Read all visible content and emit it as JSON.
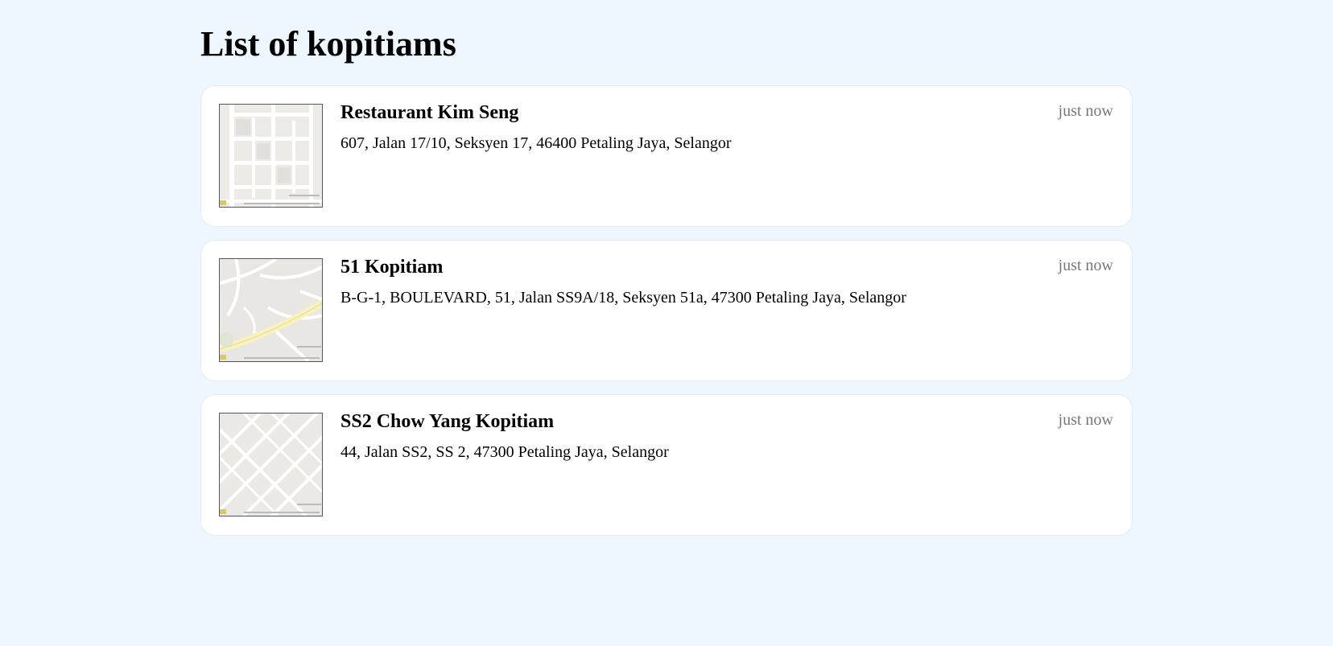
{
  "page": {
    "title": "List of kopitiams"
  },
  "kopitiams": [
    {
      "name": "Restaurant Kim Seng",
      "address": "607, Jalan 17/10, Seksyen 17, 46400 Petaling Jaya, Selangor",
      "time": "just now",
      "thumbnail_icon": "map-thumbnail"
    },
    {
      "name": "51 Kopitiam",
      "address": "B-G-1, BOULEVARD, 51, Jalan SS9A/18, Seksyen 51a, 47300 Petaling Jaya, Selangor",
      "time": "just now",
      "thumbnail_icon": "map-thumbnail"
    },
    {
      "name": "SS2 Chow Yang Kopitiam",
      "address": "44, Jalan SS2, SS 2, 47300 Petaling Jaya, Selangor",
      "time": "just now",
      "thumbnail_icon": "map-thumbnail"
    }
  ],
  "colors": {
    "background": "#eef6fe",
    "card": "#ffffff",
    "time_text": "#777777",
    "map_land": "#e8e6e2",
    "map_road": "#ffffff",
    "map_main_road": "#fbf4c8"
  }
}
